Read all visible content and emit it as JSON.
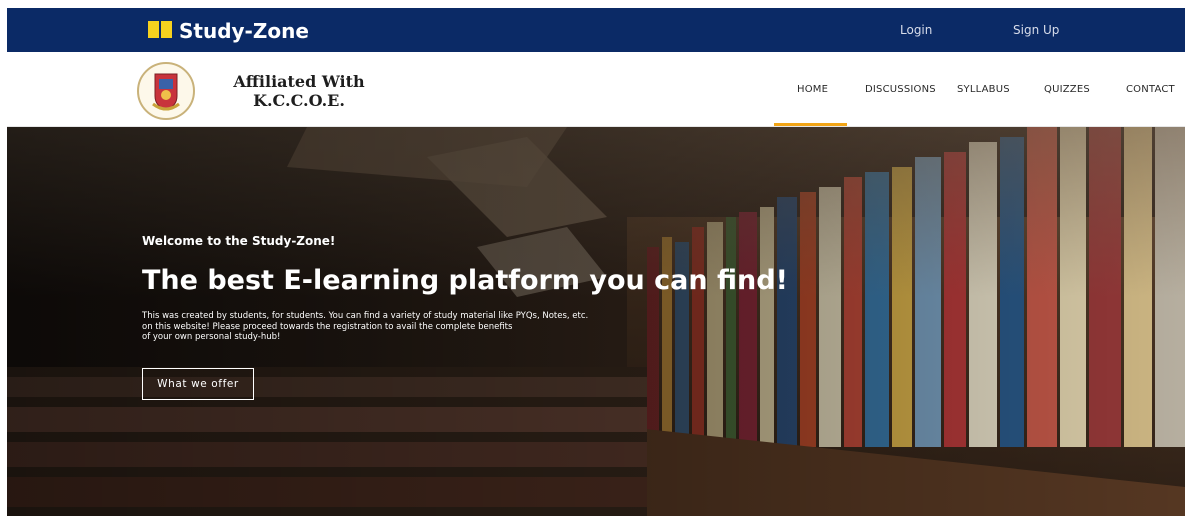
{
  "topbar": {
    "brand_name": "Study-Zone",
    "brand_icon": "book-icon",
    "login_label": "Login",
    "signup_label": "Sign Up",
    "bg_color": "#0b2a66"
  },
  "header": {
    "logo_icon": "college-emblem",
    "affiliation_line1": "Affiliated With",
    "affiliation_line2": "K.C.C.O.E."
  },
  "nav": {
    "items": [
      {
        "label": "HOME",
        "active": true
      },
      {
        "label": "DISCUSSIONS"
      },
      {
        "label": "SYLLABUS"
      },
      {
        "label": "QUIZZES"
      },
      {
        "label": "CONTACT"
      }
    ],
    "active_color": "#f2a516"
  },
  "hero": {
    "welcome": "Welcome to the Study-Zone!",
    "headline": "The best E-learning platform you can find!",
    "description": [
      "This was created by students, for students. You can find a variety of study material like PYQs, Notes, etc.",
      "on this website! Please proceed towards the registration to avail the complete benefits",
      "of your own personal study-hub!"
    ],
    "cta_label": "What we offer"
  }
}
